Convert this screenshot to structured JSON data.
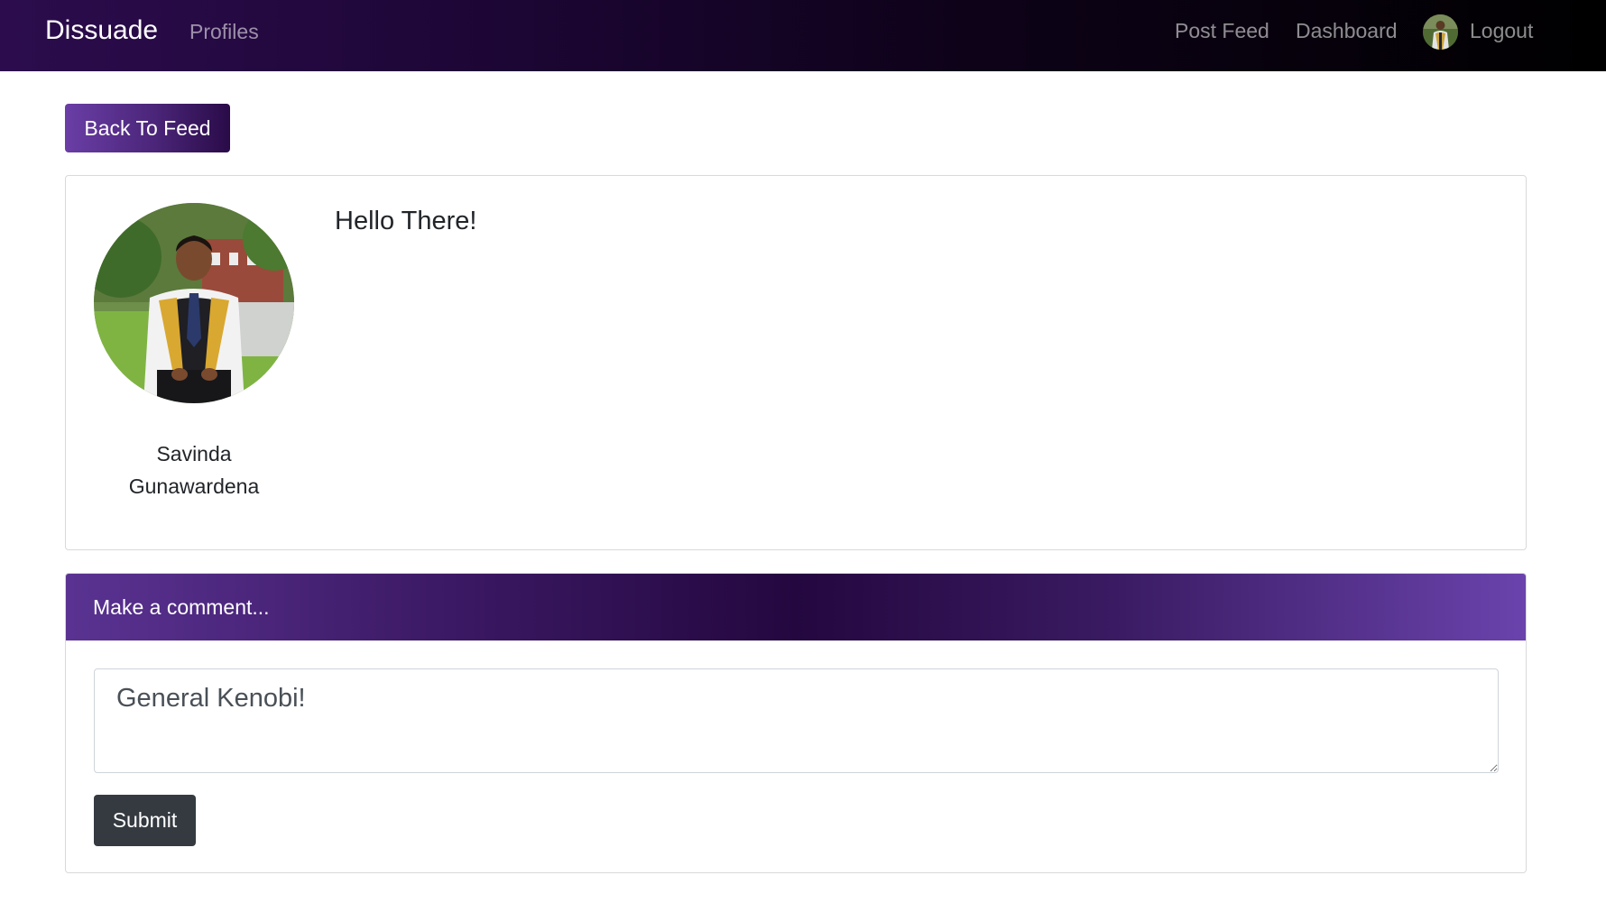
{
  "navbar": {
    "brand": "Dissuade",
    "links": {
      "profiles": "Profiles",
      "post_feed": "Post Feed",
      "dashboard": "Dashboard",
      "logout": "Logout"
    }
  },
  "actions": {
    "back_label": "Back To Feed"
  },
  "post": {
    "author_first": "Savinda",
    "author_last": "Gunawardena",
    "text": "Hello There!"
  },
  "comment_form": {
    "header": "Make a comment...",
    "textarea_value": "General Kenobi!",
    "submit_label": "Submit"
  },
  "colors": {
    "accent_purple": "#6a3ea6",
    "dark_button": "#343a40",
    "navbar_dark": "#000000"
  }
}
